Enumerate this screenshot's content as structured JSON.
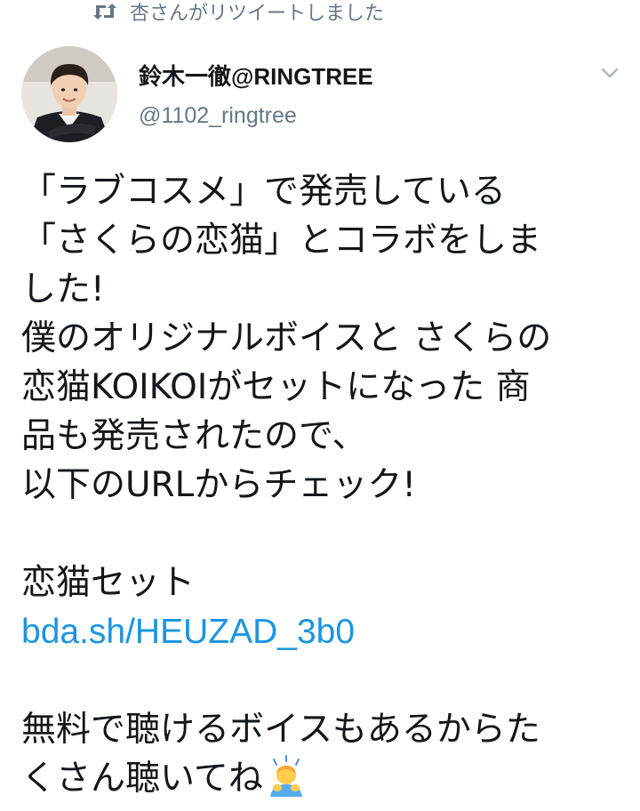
{
  "retweet": {
    "icon": "retweet-icon",
    "text": "杏さんがリツイートしました"
  },
  "author": {
    "avatar": "profile-photo",
    "display_name": "鈴木一徹@RINGTREE",
    "handle": "@1102_ringtree"
  },
  "menu": {
    "icon": "chevron-down-icon"
  },
  "tweet": {
    "lines": [
      "「ラブコスメ」で発売している",
      "「さくらの恋猫」とコラボをしま",
      "した!",
      "僕のオリジナルボイスと さくらの",
      "恋猫KOIKOIがセットになった 商",
      "品も発売されたので、",
      "以下のURLからチェック!",
      "",
      "恋猫セット"
    ],
    "link": "bda.sh/HEUZAD_3b0",
    "closing_lines": [
      "",
      "無料で聴けるボイスもあるからた",
      "くさん聴いてね"
    ],
    "emoji": "person-bowing-emoji"
  },
  "colors": {
    "text": "#14171a",
    "secondary": "#657786",
    "link": "#1b95e0",
    "background": "#ffffff"
  }
}
